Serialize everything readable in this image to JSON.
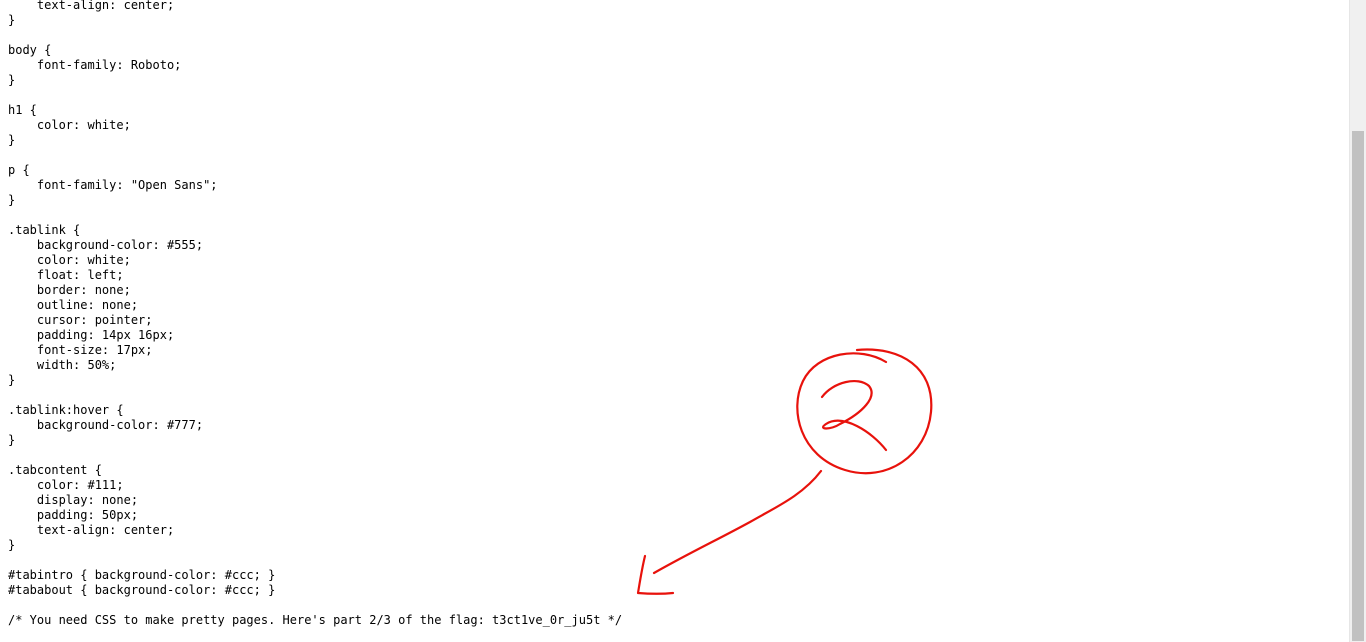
{
  "code_lines": [
    "    text-align: center;",
    "}",
    "",
    "body {",
    "    font-family: Roboto;",
    "}",
    "",
    "h1 {",
    "    color: white;",
    "}",
    "",
    "p {",
    "    font-family: \"Open Sans\";",
    "}",
    "",
    ".tablink {",
    "    background-color: #555;",
    "    color: white;",
    "    float: left;",
    "    border: none;",
    "    outline: none;",
    "    cursor: pointer;",
    "    padding: 14px 16px;",
    "    font-size: 17px;",
    "    width: 50%;",
    "}",
    "",
    ".tablink:hover {",
    "    background-color: #777;",
    "}",
    "",
    ".tabcontent {",
    "    color: #111;",
    "    display: none;",
    "    padding: 50px;",
    "    text-align: center;",
    "}",
    "",
    "#tabintro { background-color: #ccc; }",
    "#tababout { background-color: #ccc; }",
    "",
    "/* You need CSS to make pretty pages. Here's part 2/3 of the flag: t3ct1ve_0r_ju5t */"
  ],
  "annotation": {
    "color": "#e8120c",
    "icon": "handwritten-circled-2-arrow"
  }
}
